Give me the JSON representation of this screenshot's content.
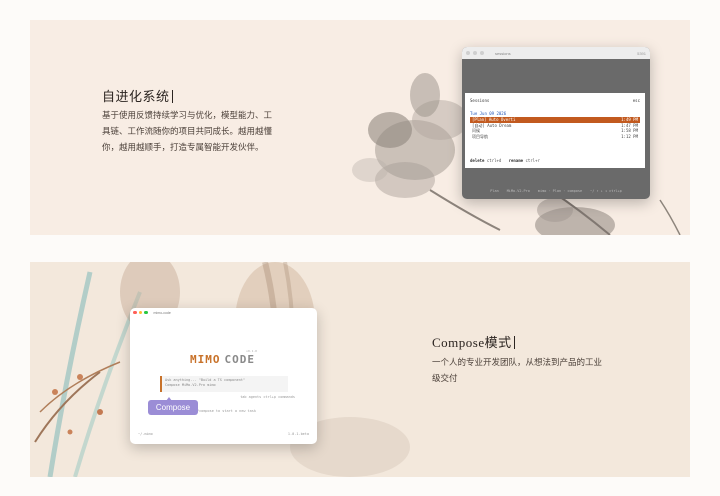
{
  "card1": {
    "title": "自进化系统",
    "desc_lines": [
      "基于使用反馈持续学习与优化，模型能力、工",
      "具链、工作流随你的项目共同成长。越用越懂",
      "你，越用越顺手，打造专属智能开发伙伴。"
    ],
    "terminal": {
      "window_title": "sessions",
      "window_right": "5391",
      "panel_title": "Sessions",
      "panel_right": "esc",
      "date": "Tue Jun 09 2026",
      "rows": [
        {
          "name": "[Plan] Auto Overti",
          "time": "1:49 PM",
          "selected": true
        },
        {
          "name": "[自动] Auto Dream",
          "time": "1:47 PM",
          "selected": false
        },
        {
          "name": "问候",
          "time": "1:58 PM",
          "selected": false
        },
        {
          "name": "项目导航",
          "time": "1:12 PM",
          "selected": false
        }
      ],
      "footer_delete": "delete",
      "footer_delete_key": "ctrl+d",
      "footer_rename": "rename",
      "footer_rename_key": "ctrl+r",
      "status": [
        "Plan",
        "MiMo-V2-Pro",
        "mimo · Plan · compose"
      ],
      "status_right": "~/ ↑ ↓ ⇥ ctrl+p"
    }
  },
  "card2": {
    "title": "Compose模式",
    "desc_lines": [
      "一个人的专业开发团队，从想法到产品的工业",
      "级交付"
    ],
    "mimo_window": {
      "window_title": "mimo-code",
      "logo_left": "MIMO",
      "logo_right": "CODE",
      "version": "v0.1.0",
      "input_line1": "Ask anything... \"Build a TS component\"",
      "input_line2": "Compose  MiMo-V2-Pro  mimo",
      "hint": "tab agents  ctrl+p commands",
      "tip": "Tip: Use /compose to start a new task",
      "footer_left": "~/.mimo",
      "footer_right": "1.0.1-beta"
    },
    "badge": "Compose"
  },
  "colors": {
    "accent_orange": "#c25a1f",
    "badge_purple": "#9b8dd6",
    "date_blue": "#2458b8"
  }
}
